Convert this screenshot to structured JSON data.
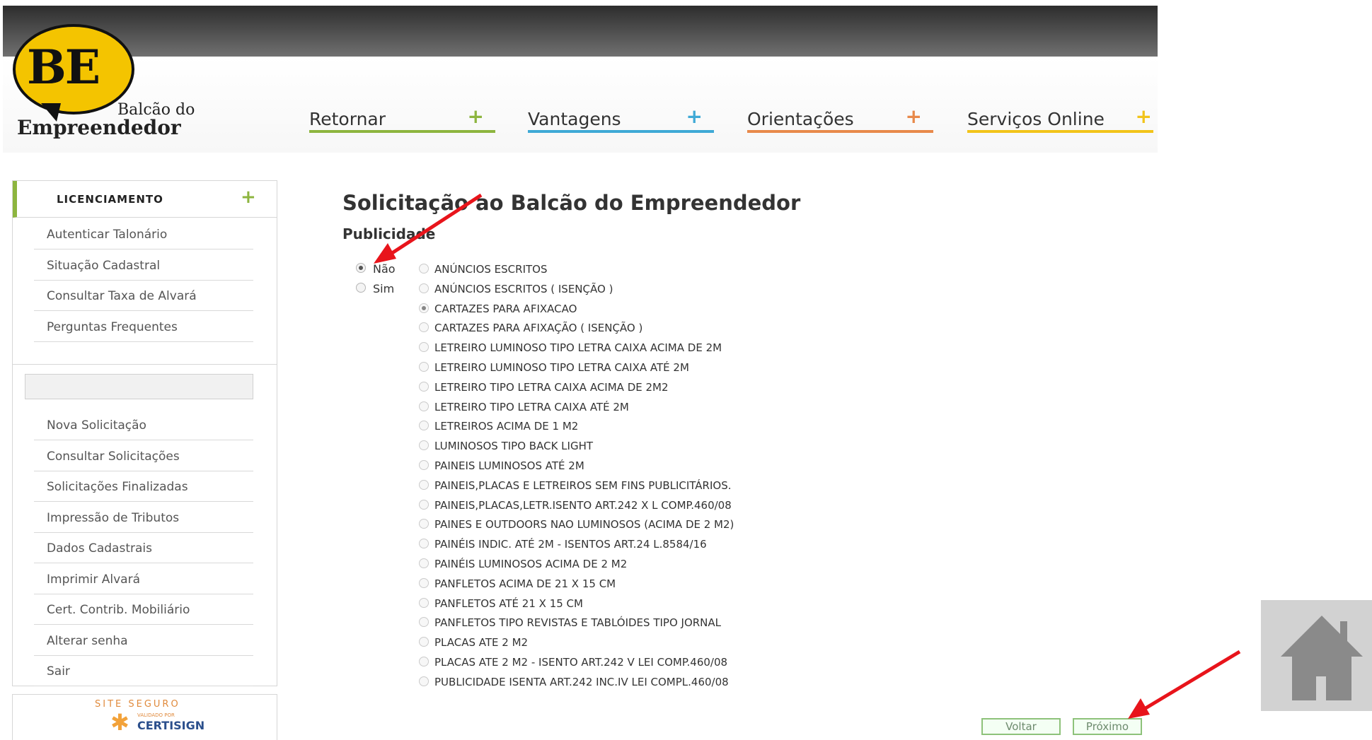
{
  "logo": {
    "initials": "BE",
    "line1": "Balcão do",
    "line2": "Empreendedor"
  },
  "nav": [
    {
      "label": "Retornar",
      "plus": "+",
      "color": "#8db53f"
    },
    {
      "label": "Vantagens",
      "plus": "+",
      "color": "#3fa9d6"
    },
    {
      "label": "Orientações",
      "plus": "+",
      "color": "#e8894a"
    },
    {
      "label": "Serviços Online",
      "plus": "+",
      "color": "#f2c41a"
    }
  ],
  "sidebar": {
    "header": "LICENCIAMENTO",
    "header_plus": "+",
    "top_items": [
      "Autenticar Talonário",
      "Situação Cadastral",
      "Consultar Taxa de Alvará",
      "Perguntas Frequentes"
    ],
    "search_value": "",
    "items": [
      "Nova Solicitação",
      "Consultar Solicitações",
      "Solicitações Finalizadas",
      "Impressão de Tributos",
      "Dados Cadastrais",
      "Imprimir Alvará",
      "Cert. Contrib. Mobiliário",
      "Alterar senha",
      "Sair"
    ]
  },
  "secure_seal": {
    "line1": "SITE SEGURO",
    "line2": "VALIDADO POR",
    "brand": "CERTISIGN"
  },
  "main": {
    "title": "Solicitação ao Balcão do Empreendedor",
    "subtitle": "Publicidade",
    "choice": [
      {
        "label": "Não",
        "checked": true
      },
      {
        "label": "Sim",
        "checked": false
      }
    ],
    "options": [
      {
        "label": "ANÚNCIOS ESCRITOS",
        "checked": false
      },
      {
        "label": "ANÚNCIOS ESCRITOS ( ISENÇÃO )",
        "checked": false
      },
      {
        "label": "CARTAZES PARA AFIXACAO",
        "checked": true
      },
      {
        "label": "CARTAZES PARA AFIXAÇÃO ( ISENÇÃO )",
        "checked": false
      },
      {
        "label": "LETREIRO LUMINOSO TIPO LETRA CAIXA ACIMA DE 2M",
        "checked": false
      },
      {
        "label": "LETREIRO LUMINOSO TIPO LETRA CAIXA ATÉ 2M",
        "checked": false
      },
      {
        "label": "LETREIRO TIPO LETRA CAIXA ACIMA DE 2M2",
        "checked": false
      },
      {
        "label": "LETREIRO TIPO LETRA CAIXA ATÉ 2M",
        "checked": false
      },
      {
        "label": "LETREIROS ACIMA DE 1 M2",
        "checked": false
      },
      {
        "label": "LUMINOSOS TIPO BACK LIGHT",
        "checked": false
      },
      {
        "label": "PAINEIS LUMINOSOS ATÉ 2M",
        "checked": false
      },
      {
        "label": "PAINEIS,PLACAS E LETREIROS SEM FINS PUBLICITÁRIOS.",
        "checked": false
      },
      {
        "label": "PAINEIS,PLACAS,LETR.ISENTO ART.242 X L COMP.460/08",
        "checked": false
      },
      {
        "label": "PAINES E OUTDOORS NAO LUMINOSOS (ACIMA DE 2 M2)",
        "checked": false
      },
      {
        "label": "PAINÉIS INDIC. ATÉ 2M - ISENTOS ART.24 L.8584/16",
        "checked": false
      },
      {
        "label": "PAINÉIS LUMINOSOS ACIMA DE 2 M2",
        "checked": false
      },
      {
        "label": "PANFLETOS ACIMA DE 21 X 15 CM",
        "checked": false
      },
      {
        "label": "PANFLETOS ATÉ 21 X 15 CM",
        "checked": false
      },
      {
        "label": "PANFLETOS TIPO REVISTAS E TABLÓIDES TIPO JORNAL",
        "checked": false
      },
      {
        "label": "PLACAS ATE 2 M2",
        "checked": false
      },
      {
        "label": "PLACAS ATE 2 M2 - ISENTO ART.242 V LEI COMP.460/08",
        "checked": false
      },
      {
        "label": "PUBLICIDADE ISENTA ART.242 INC.IV LEI COMPL.460/08",
        "checked": false
      }
    ],
    "buttons": {
      "back": "Voltar",
      "next": "Próximo"
    }
  },
  "home_icon": "home-icon",
  "annotation_color": "#e8141b"
}
